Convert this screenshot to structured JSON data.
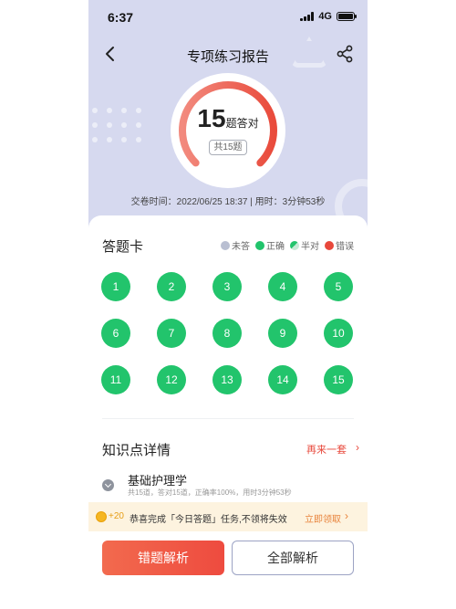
{
  "status_bar": {
    "time": "6:37",
    "network": "4G"
  },
  "header": {
    "title": "专项练习报告"
  },
  "score": {
    "correct": "15",
    "unit": "题答对",
    "total_label": "共15题",
    "correct_ratio": 1.0
  },
  "submit_info": "交卷时间：2022/06/25 18:37 | 用时：3分钟53秒",
  "answer_card": {
    "title": "答题卡",
    "legend": [
      {
        "label": "未答",
        "color": "#b9bfd2"
      },
      {
        "label": "正确",
        "color": "#22c46c"
      },
      {
        "label": "半对",
        "color": "#22c46c"
      },
      {
        "label": "错误",
        "color": "#e8483b"
      }
    ],
    "questions": [
      {
        "num": "1",
        "status": "正确"
      },
      {
        "num": "2",
        "status": "正确"
      },
      {
        "num": "3",
        "status": "正确"
      },
      {
        "num": "4",
        "status": "正确"
      },
      {
        "num": "5",
        "status": "正确"
      },
      {
        "num": "6",
        "status": "正确"
      },
      {
        "num": "7",
        "status": "正确"
      },
      {
        "num": "8",
        "status": "正确"
      },
      {
        "num": "9",
        "status": "正确"
      },
      {
        "num": "10",
        "status": "正确"
      },
      {
        "num": "11",
        "status": "正确"
      },
      {
        "num": "12",
        "status": "正确"
      },
      {
        "num": "13",
        "status": "正确"
      },
      {
        "num": "14",
        "status": "正确"
      },
      {
        "num": "15",
        "status": "正确"
      }
    ]
  },
  "knowledge": {
    "title": "知识点详情",
    "retry_label": "再来一套",
    "items": [
      {
        "name": "基础护理学",
        "meta": "共15道，答对15道，正确率100%，用时3分钟53秒"
      }
    ]
  },
  "banner": {
    "coin_value": "+20",
    "text": "恭喜完成「今日答题」任务,不领将失效",
    "claim_label": "立即领取"
  },
  "actions": {
    "wrong_label": "错题解析",
    "all_label": "全部解析"
  },
  "colors": {
    "accent_green": "#22c46c",
    "accent_red": "#e8483b",
    "hero_bg": "#d6d9ef"
  }
}
